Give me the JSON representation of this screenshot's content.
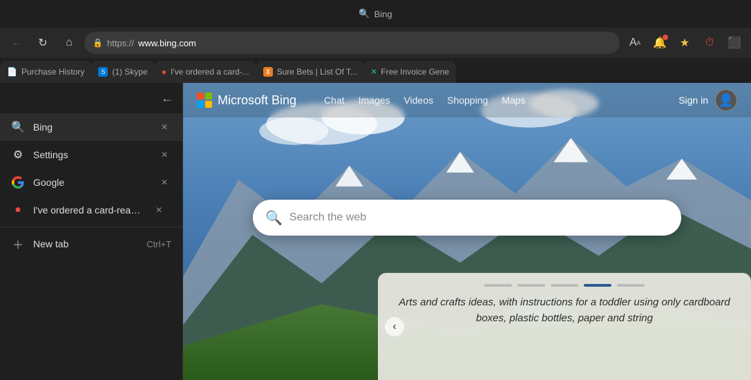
{
  "browser": {
    "title": "Bing",
    "address": {
      "protocol": "https://",
      "domain": "www.bing.com"
    },
    "tabs": [
      {
        "id": "purchase-history",
        "label": "Purchase History",
        "icon": "📄",
        "closable": false
      },
      {
        "id": "skype",
        "label": "(1) Skype",
        "icon": "⬛",
        "closable": false
      },
      {
        "id": "card-order",
        "label": "I've ordered a card-...",
        "icon": "🔴",
        "closable": false
      },
      {
        "id": "sure-bets",
        "label": "Sure Bets | List Of T...",
        "icon": "🟧",
        "closable": false
      },
      {
        "id": "invoice",
        "label": "Free Invoice Gene",
        "icon": "❎",
        "closable": false
      }
    ],
    "nav_icons": {
      "font_size": "A",
      "notifications": "🔔",
      "favorites": "★",
      "timer": "⏱",
      "extensions": "⬛"
    }
  },
  "sidebar": {
    "items": [
      {
        "id": "bing",
        "label": "Bing",
        "icon": "search",
        "closable": true
      },
      {
        "id": "settings",
        "label": "Settings",
        "icon": "settings",
        "closable": true
      },
      {
        "id": "google",
        "label": "Google",
        "icon": "google",
        "closable": true
      },
      {
        "id": "card-order",
        "label": "I've ordered a card-reader b...",
        "icon": "red-dot",
        "closable": true
      }
    ],
    "new_tab": {
      "label": "New tab",
      "shortcut": "Ctrl+T"
    }
  },
  "bing": {
    "logo_text": "Microsoft Bing",
    "nav_items": [
      "Chat",
      "Images",
      "Videos",
      "Shopping",
      "Maps"
    ],
    "search_placeholder": "Search the web",
    "signin_label": "Sign in",
    "bottom_card": {
      "dots": [
        false,
        false,
        false,
        true,
        false
      ],
      "text": "Arts and crafts ideas, with instructions for a toddler using only cardboard boxes, plastic bottles, paper and string"
    }
  }
}
